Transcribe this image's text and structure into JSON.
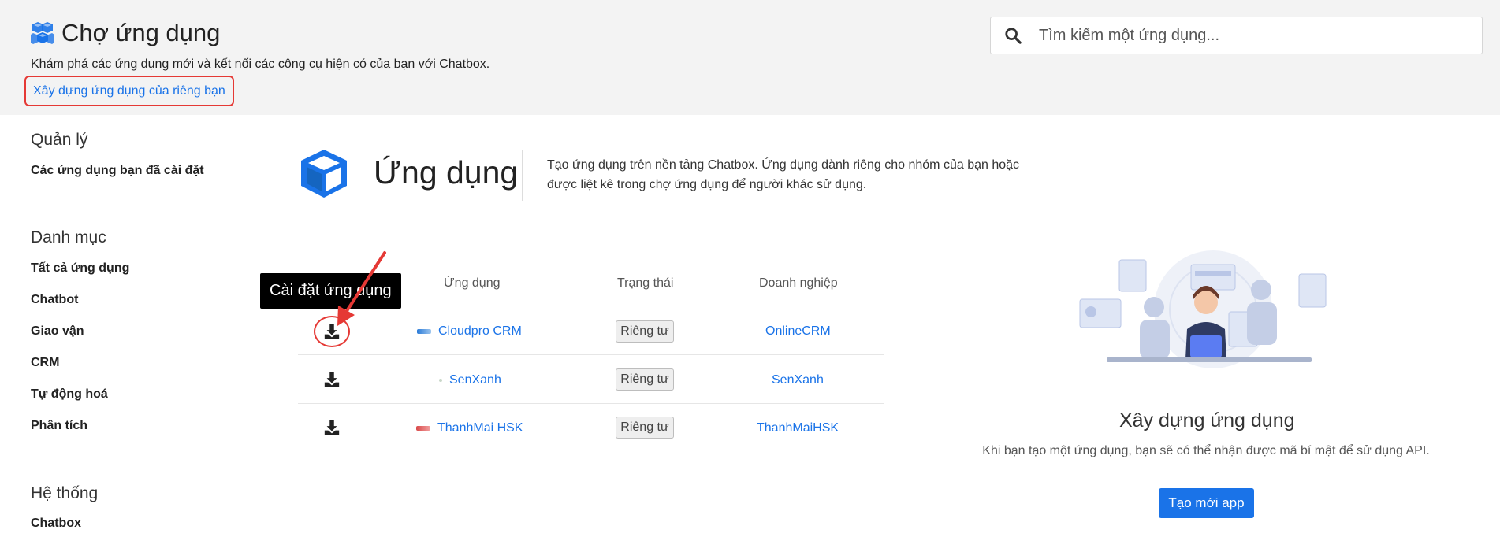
{
  "header": {
    "title": "Chợ ứng dụng",
    "subtitle": "Khám phá các ứng dụng mới và kết nối các công cụ hiện có của bạn với Chatbox.",
    "build_link": "Xây dựng ứng dụng của riêng bạn",
    "search_placeholder": "Tìm kiếm một ứng dụng..."
  },
  "sidebar": {
    "manage": {
      "title": "Quản lý",
      "items": [
        "Các ứng dụng bạn đã cài đặt"
      ]
    },
    "categories": {
      "title": "Danh mục",
      "items": [
        "Tất cả ứng dụng",
        "Chatbot",
        "Giao vận",
        "CRM",
        "Tự động hoá",
        "Phân tích"
      ]
    },
    "system": {
      "title": "Hệ thống",
      "items": [
        "Chatbox"
      ]
    }
  },
  "hero": {
    "title": "Ứng dụng",
    "description": "Tạo ứng dụng trên nền tảng Chatbox. Ứng dụng dành riêng cho nhóm của bạn hoặc được liệt kê trong chợ ứng dụng để người khác sử dụng."
  },
  "table": {
    "columns": [
      "Ứng dụng",
      "Trạng thái",
      "Doanh nghiệp"
    ],
    "rows": [
      {
        "app": "Cloudpro CRM",
        "status": "Riêng tư",
        "company": "OnlineCRM"
      },
      {
        "app": "SenXanh",
        "status": "Riêng tư",
        "company": "SenXanh"
      },
      {
        "app": "ThanhMai HSK",
        "status": "Riêng tư",
        "company": "ThanhMaiHSK"
      }
    ]
  },
  "tooltip": "Cài đặt ứng dụng",
  "cta": {
    "title": "Xây dựng ứng dụng",
    "description": "Khi bạn tạo một ứng dụng, bạn sẽ có thể nhận được mã bí mật để sử dụng API.",
    "button": "Tạo mới app"
  },
  "colors": {
    "accent": "#1a73e8",
    "highlight": "#e53935",
    "header_bg": "#f3f3f3"
  },
  "icons": {
    "title": "cubes-icon",
    "search": "search-icon",
    "hero": "box-icon",
    "install": "download-icon"
  }
}
